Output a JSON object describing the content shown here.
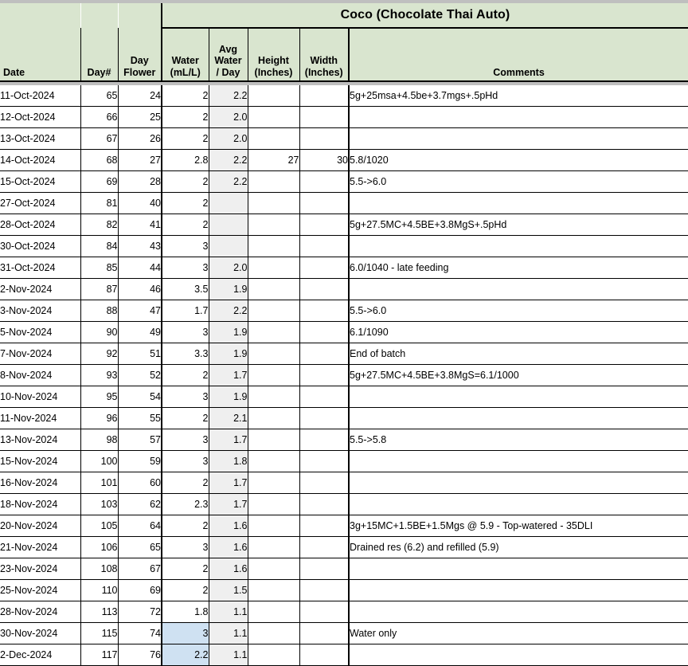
{
  "sheet": {
    "title": "Coco (Chocolate Thai Auto)",
    "accent_header_bg": "#D9E5CF",
    "avg_column_bg": "#EFEFEF",
    "highlight_bg": "#CFE1F2"
  },
  "columns": {
    "date": "Date",
    "day_num": "Day#",
    "day_flower_l1": "Day",
    "day_flower_l2": "Flower",
    "water_l1": "Water",
    "water_l2": "(mL/L)",
    "avg_water_l1": "Avg",
    "avg_water_l2": "Water",
    "avg_water_l3": "/ Day",
    "height_l1": "Height",
    "height_l2": "(Inches)",
    "width_l1": "Width",
    "width_l2": "(Inches)",
    "comments": "Comments"
  },
  "rows": [
    {
      "date": "11-Oct-2024",
      "day": "65",
      "flower": "24",
      "water": "2",
      "avg": "2.2",
      "height": "",
      "width": "",
      "comment": "5g+25msa+4.5be+3.7mgs+.5pHd",
      "water_hl": false
    },
    {
      "date": "12-Oct-2024",
      "day": "66",
      "flower": "25",
      "water": "2",
      "avg": "2.0",
      "height": "",
      "width": "",
      "comment": "",
      "water_hl": false
    },
    {
      "date": "13-Oct-2024",
      "day": "67",
      "flower": "26",
      "water": "2",
      "avg": "2.0",
      "height": "",
      "width": "",
      "comment": "",
      "water_hl": false
    },
    {
      "date": "14-Oct-2024",
      "day": "68",
      "flower": "27",
      "water": "2.8",
      "avg": "2.2",
      "height": "27",
      "width": "30",
      "comment": "5.8/1020",
      "water_hl": false
    },
    {
      "date": "15-Oct-2024",
      "day": "69",
      "flower": "28",
      "water": "2",
      "avg": "2.2",
      "height": "",
      "width": "",
      "comment": "5.5->6.0",
      "water_hl": false
    },
    {
      "date": "27-Oct-2024",
      "day": "81",
      "flower": "40",
      "water": "2",
      "avg": "",
      "height": "",
      "width": "",
      "comment": "",
      "water_hl": false
    },
    {
      "date": "28-Oct-2024",
      "day": "82",
      "flower": "41",
      "water": "2",
      "avg": "",
      "height": "",
      "width": "",
      "comment": "5g+27.5MC+4.5BE+3.8MgS+.5pHd",
      "water_hl": false
    },
    {
      "date": "30-Oct-2024",
      "day": "84",
      "flower": "43",
      "water": "3",
      "avg": "",
      "height": "",
      "width": "",
      "comment": "",
      "water_hl": false
    },
    {
      "date": "31-Oct-2024",
      "day": "85",
      "flower": "44",
      "water": "3",
      "avg": "2.0",
      "height": "",
      "width": "",
      "comment": "6.0/1040 - late feeding",
      "water_hl": false
    },
    {
      "date": "2-Nov-2024",
      "day": "87",
      "flower": "46",
      "water": "3.5",
      "avg": "1.9",
      "height": "",
      "width": "",
      "comment": "",
      "water_hl": false
    },
    {
      "date": "3-Nov-2024",
      "day": "88",
      "flower": "47",
      "water": "1.7",
      "avg": "2.2",
      "height": "",
      "width": "",
      "comment": "5.5->6.0",
      "water_hl": false
    },
    {
      "date": "5-Nov-2024",
      "day": "90",
      "flower": "49",
      "water": "3",
      "avg": "1.9",
      "height": "",
      "width": "",
      "comment": "6.1/1090",
      "water_hl": false
    },
    {
      "date": "7-Nov-2024",
      "day": "92",
      "flower": "51",
      "water": "3.3",
      "avg": "1.9",
      "height": "",
      "width": "",
      "comment": "End of batch",
      "water_hl": false
    },
    {
      "date": "8-Nov-2024",
      "day": "93",
      "flower": "52",
      "water": "2",
      "avg": "1.7",
      "height": "",
      "width": "",
      "comment": "5g+27.5MC+4.5BE+3.8MgS=6.1/1000",
      "water_hl": false
    },
    {
      "date": "10-Nov-2024",
      "day": "95",
      "flower": "54",
      "water": "3",
      "avg": "1.9",
      "height": "",
      "width": "",
      "comment": "",
      "water_hl": false
    },
    {
      "date": "11-Nov-2024",
      "day": "96",
      "flower": "55",
      "water": "2",
      "avg": "2.1",
      "height": "",
      "width": "",
      "comment": "",
      "water_hl": false
    },
    {
      "date": "13-Nov-2024",
      "day": "98",
      "flower": "57",
      "water": "3",
      "avg": "1.7",
      "height": "",
      "width": "",
      "comment": "5.5->5.8",
      "water_hl": false
    },
    {
      "date": "15-Nov-2024",
      "day": "100",
      "flower": "59",
      "water": "3",
      "avg": "1.8",
      "height": "",
      "width": "",
      "comment": "",
      "water_hl": false
    },
    {
      "date": "16-Nov-2024",
      "day": "101",
      "flower": "60",
      "water": "2",
      "avg": "1.7",
      "height": "",
      "width": "",
      "comment": "",
      "water_hl": false
    },
    {
      "date": "18-Nov-2024",
      "day": "103",
      "flower": "62",
      "water": "2.3",
      "avg": "1.7",
      "height": "",
      "width": "",
      "comment": "",
      "water_hl": false
    },
    {
      "date": "20-Nov-2024",
      "day": "105",
      "flower": "64",
      "water": "2",
      "avg": "1.6",
      "height": "",
      "width": "",
      "comment": "3g+15MC+1.5BE+1.5Mgs @ 5.9 - Top-watered - 35DLI",
      "water_hl": false
    },
    {
      "date": "21-Nov-2024",
      "day": "106",
      "flower": "65",
      "water": "3",
      "avg": "1.6",
      "height": "",
      "width": "",
      "comment": "Drained res (6.2) and refilled (5.9)",
      "water_hl": false
    },
    {
      "date": "23-Nov-2024",
      "day": "108",
      "flower": "67",
      "water": "2",
      "avg": "1.6",
      "height": "",
      "width": "",
      "comment": "",
      "water_hl": false
    },
    {
      "date": "25-Nov-2024",
      "day": "110",
      "flower": "69",
      "water": "2",
      "avg": "1.5",
      "height": "",
      "width": "",
      "comment": "",
      "water_hl": false
    },
    {
      "date": "28-Nov-2024",
      "day": "113",
      "flower": "72",
      "water": "1.8",
      "avg": "1.1",
      "height": "",
      "width": "",
      "comment": "",
      "water_hl": false
    },
    {
      "date": "30-Nov-2024",
      "day": "115",
      "flower": "74",
      "water": "3",
      "avg": "1.1",
      "height": "",
      "width": "",
      "comment": "Water only",
      "water_hl": true
    },
    {
      "date": "2-Dec-2024",
      "day": "117",
      "flower": "76",
      "water": "2.2",
      "avg": "1.1",
      "height": "",
      "width": "",
      "comment": "",
      "water_hl": true
    }
  ]
}
